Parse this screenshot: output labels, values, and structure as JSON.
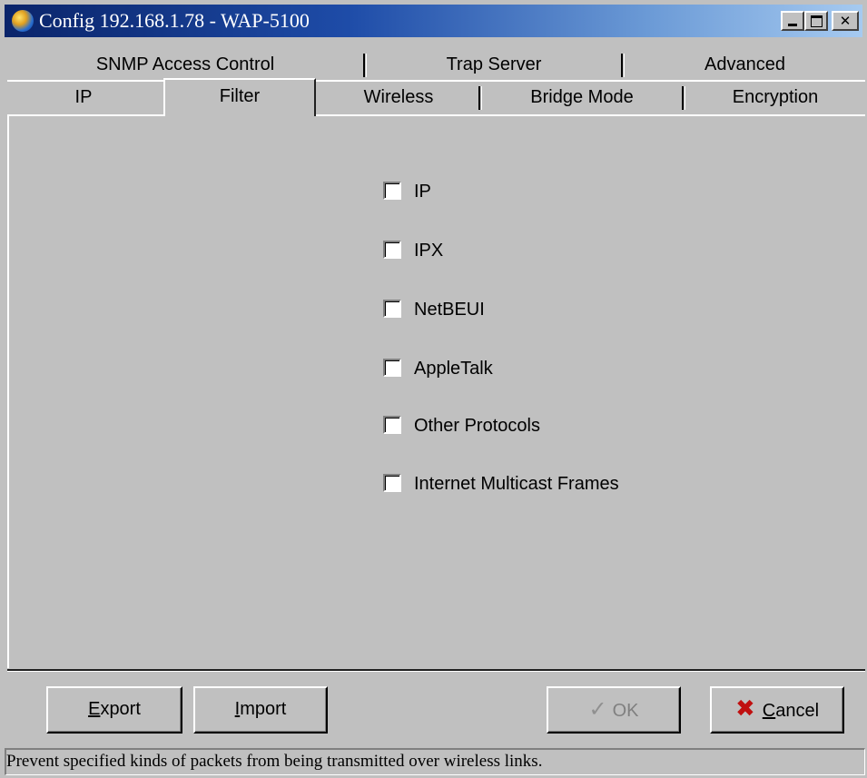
{
  "window": {
    "title": "Config 192.168.1.78 - WAP-5100",
    "controls": {
      "minimize": "minimize",
      "maximize": "maximize",
      "close": "✕"
    }
  },
  "tabs": {
    "row_back": [
      {
        "label": "SNMP Access Control"
      },
      {
        "label": "Trap Server"
      },
      {
        "label": "Advanced"
      }
    ],
    "row_front": [
      {
        "label": "IP"
      },
      {
        "label": "Filter",
        "active": true
      },
      {
        "label": "Wireless"
      },
      {
        "label": "Bridge Mode"
      },
      {
        "label": "Encryption"
      }
    ]
  },
  "filters": [
    {
      "label": "IP",
      "checked": false
    },
    {
      "label": "IPX",
      "checked": false
    },
    {
      "label": "NetBEUI",
      "checked": false
    },
    {
      "label": "AppleTalk",
      "checked": false
    },
    {
      "label": "Other Protocols",
      "checked": false
    },
    {
      "label": "Internet Multicast Frames",
      "checked": false
    }
  ],
  "buttons": {
    "export": {
      "mnemonic": "E",
      "rest": "xport"
    },
    "import": {
      "mnemonic": "I",
      "rest": "mport"
    },
    "ok": {
      "label": "OK",
      "disabled": true,
      "icon": "checkmark-icon"
    },
    "cancel": {
      "mnemonic": "C",
      "rest": "ancel",
      "icon": "red-x-icon"
    }
  },
  "status": {
    "text": "Prevent specified kinds of packets from being transmitted over wireless links."
  },
  "colors": {
    "titlebar_start": "#0a246a",
    "titlebar_end": "#a6caf0",
    "face": "#c0c0c0",
    "cancel_icon": "#c01010"
  }
}
